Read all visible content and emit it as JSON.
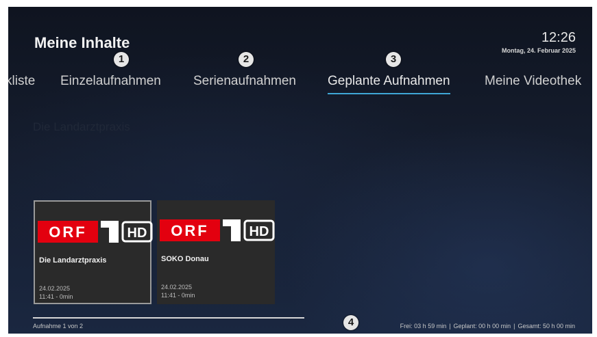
{
  "header": {
    "title": "Meine Inhalte",
    "time": "12:26",
    "date": "Montag, 24. Februar 2025"
  },
  "tabs": [
    {
      "label": "kliste"
    },
    {
      "label": "Einzelaufnahmen"
    },
    {
      "label": "Serienaufnahmen"
    },
    {
      "label": "Geplante Aufnahmen",
      "active": true
    },
    {
      "label": "Meine Videothek"
    }
  ],
  "markers": [
    "1",
    "2",
    "3",
    "4"
  ],
  "section": {
    "heading": "Die Landarztpraxis"
  },
  "recordings": [
    {
      "channel_logo": "ORF 1 HD",
      "title": "Die Landarztpraxis",
      "date": "24.02.2025",
      "time": "11:41 - 0min",
      "selected": true
    },
    {
      "channel_logo": "ORF 1 HD",
      "title": "SOKO Donau",
      "date": "24.02.2025",
      "time": "11:41 - 0min",
      "selected": false
    }
  ],
  "footer": {
    "position": "Aufnahme 1 von 2",
    "free": "Frei: 03 h 59 min",
    "planned": "Geplant: 00 h 00 min",
    "total": "Gesamt: 50 h 00 min",
    "separator": "|"
  },
  "colors": {
    "accent": "#3fa7d6",
    "orf_red": "#e3000f"
  }
}
